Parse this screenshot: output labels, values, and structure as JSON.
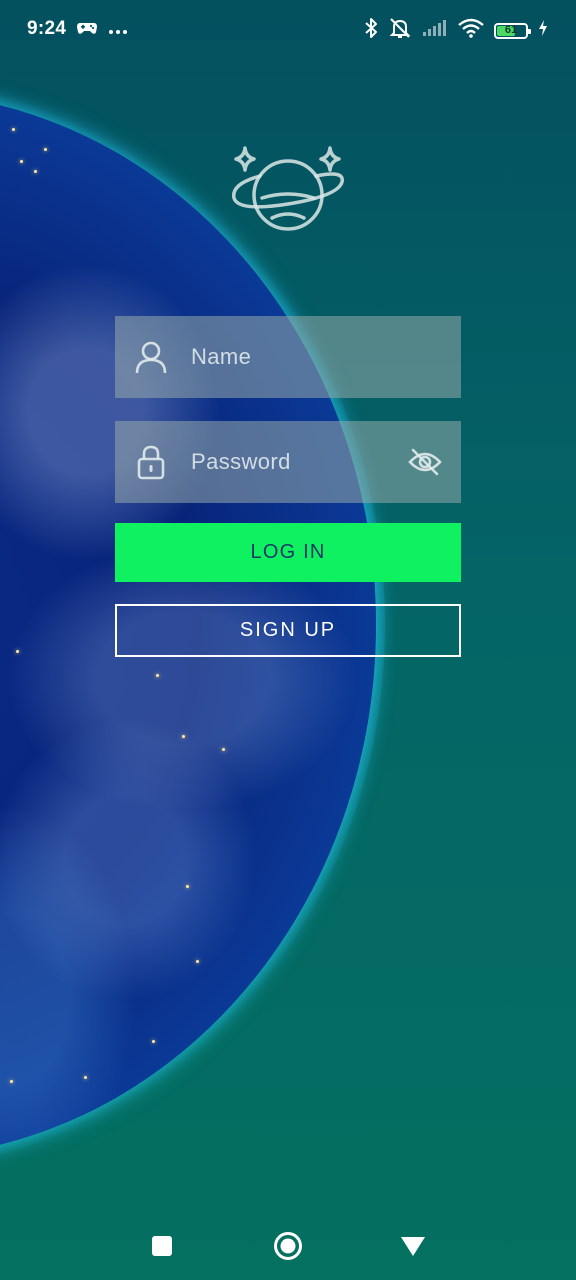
{
  "status_bar": {
    "time": "9:24",
    "left_icons": [
      "game-controller-icon",
      "more-dots-icon"
    ],
    "right_icons": [
      "bluetooth-icon",
      "silent-mode-icon",
      "cell-signal-icon",
      "wifi-icon",
      "battery-icon",
      "charging-icon"
    ],
    "battery_level": "61",
    "battery_fraction": 0.61
  },
  "logo": {
    "icon": "planet-logo-icon"
  },
  "login_form": {
    "name_field": {
      "icon": "user-icon",
      "placeholder": "Name",
      "value": ""
    },
    "password_field": {
      "icon": "lock-icon",
      "placeholder": "Password",
      "value": "",
      "toggle_icon": "eye-off-icon"
    },
    "login_label": "LOG IN",
    "signup_label": "SIGN UP"
  },
  "nav_bar": {
    "buttons": [
      "recent-apps-square-icon",
      "home-circle-icon",
      "back-triangle-icon"
    ]
  },
  "colors": {
    "background_top": "#03505f",
    "background_bottom": "#047060",
    "login_button": "#0ff160",
    "login_text": "#173a66",
    "field_background": "rgba(150,170,170,0.55)",
    "earth_glow": "#2ed7ff"
  }
}
